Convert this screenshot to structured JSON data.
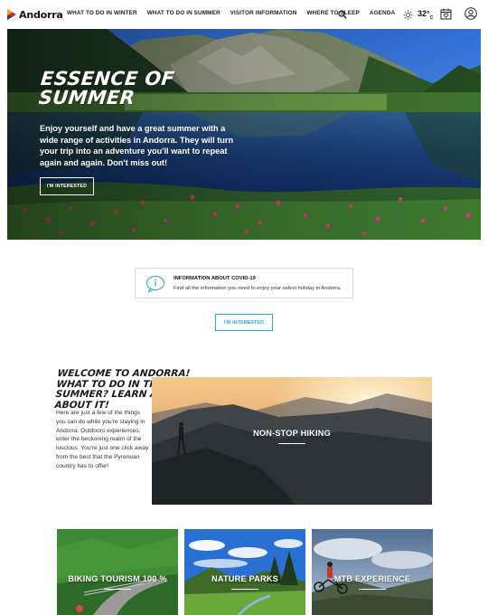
{
  "header": {
    "logo_text": "Andorra",
    "nav": [
      "WHAT TO DO IN WINTER",
      "WHAT TO DO IN SUMMER",
      "VISITOR INFORMATION",
      "WHERE TO SLEEP",
      "AGENDA"
    ],
    "temperature": "32°",
    "temperature_unit": "C"
  },
  "hero": {
    "title": "ESSENCE OF SUMMER",
    "text": "Enjoy yourself and have a great summer with a wide range of activities in Andorra. They will turn your trip into an adventure you'll want to repeat again and again. Don't miss out!",
    "button": "I'M INTERESTED"
  },
  "covid": {
    "title": "INFORMATION ABOUT COVID-19",
    "text": "Find all the information you need to enjoy your safest holiday in Andorra."
  },
  "center_button": "I'M INTERESTED",
  "welcome": {
    "title": "WELCOME TO ANDORRA! WHAT TO DO IN THE SUMMER? LEARN ALL ABOUT IT!",
    "text": "Here are just a few of the things you can do while you're staying in Andorra. Outdoors experiences: enter the beckoning realm of the luscious. You're just one click away from the best that the Pyrenean country has to offer!"
  },
  "cards": {
    "hiking": "NON-STOP HIKING",
    "biking": "BIKING TOURISM 100 %",
    "parks": "NATURE PARKS",
    "mtb": "MTB EXPERIENCE"
  },
  "colors": {
    "accent": "#2aa6d6",
    "logo_orange": "#f0a11c",
    "logo_red": "#d6202a",
    "logo_blue": "#1d3f8f"
  },
  "icons": {
    "logo": "andorra-logo-mark",
    "search": "search-icon",
    "weather": "sun-icon",
    "calendar": "calendar-icon",
    "user": "user-icon",
    "info": "info-bubble-icon"
  }
}
